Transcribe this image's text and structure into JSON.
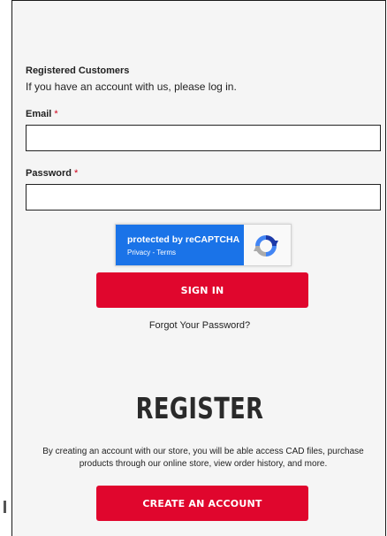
{
  "login": {
    "section_title": "Registered Customers",
    "intro": "If you have an account with us, please log in.",
    "email_label": "Email",
    "email_value": "",
    "password_label": "Password",
    "password_value": "",
    "required_mark": "*"
  },
  "recaptcha": {
    "title": "protected by reCAPTCHA",
    "privacy": "Privacy",
    "separator": " - ",
    "terms": "Terms"
  },
  "actions": {
    "sign_in": "SIGN IN",
    "forgot_password": "Forgot Your Password?"
  },
  "register": {
    "title": "REGISTER",
    "description": "By creating an account with our store, you will be able access CAD files, purchase products through our online store, view order history, and more.",
    "create_account": "CREATE AN ACCOUNT"
  },
  "colors": {
    "accent": "#e0062d",
    "recaptcha_blue": "#1a73e8",
    "required": "#d0021b"
  }
}
